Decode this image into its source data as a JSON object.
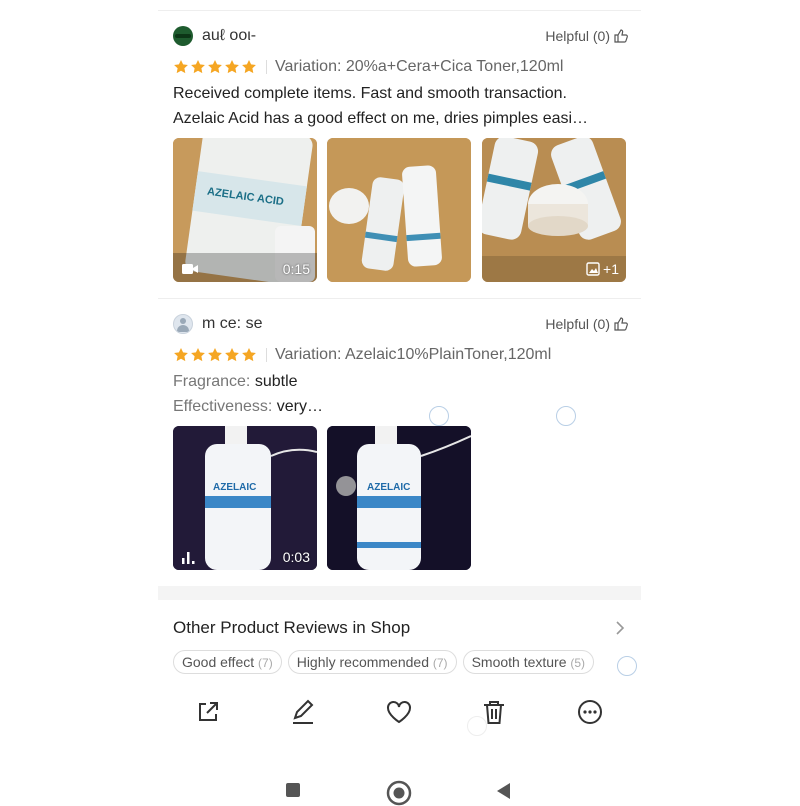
{
  "reviews": [
    {
      "username": "auℓ ooι-",
      "helpful": "Helpful (0)",
      "rating": 5,
      "variation": "Variation: 20%a+Cera+Cica Toner,120ml",
      "lines": [
        "Received complete items. Fast and smooth transaction.",
        "Azelaic Acid has a good effect on me, dries pimples easi…"
      ],
      "media": [
        {
          "kind": "video",
          "duration": "0:15",
          "label": "AZELAIC ACID"
        },
        {
          "kind": "image"
        },
        {
          "kind": "image",
          "more": "+1"
        }
      ]
    },
    {
      "username": "m  ce: se",
      "helpful": "Helpful (0)",
      "rating": 5,
      "variation": "Variation: Azelaic10%PlainToner,120ml",
      "attributes": [
        {
          "label": "Fragrance:",
          "value": "subtle"
        },
        {
          "label": "Effectiveness:",
          "value": "very…"
        }
      ],
      "media": [
        {
          "kind": "video",
          "duration": "0:03",
          "label": "AZELAIC"
        },
        {
          "kind": "image",
          "label": "AZELAIC"
        }
      ]
    }
  ],
  "section": {
    "title": "Other Product Reviews in Shop"
  },
  "tags": [
    {
      "label": "Good effect",
      "count": "(7)"
    },
    {
      "label": "Highly recommended",
      "count": "(7)"
    },
    {
      "label": "Smooth texture",
      "count": "(5)"
    }
  ],
  "toolbar": {
    "icons": [
      "share-icon",
      "edit-icon",
      "heart-icon",
      "trash-icon",
      "more-icon"
    ]
  },
  "nav": {
    "icons": [
      "recents-icon",
      "home-icon",
      "back-icon"
    ]
  },
  "colors": {
    "star": "#f5a623",
    "accent": "#1a8fb0",
    "text": "#222222",
    "muted": "#777777"
  }
}
